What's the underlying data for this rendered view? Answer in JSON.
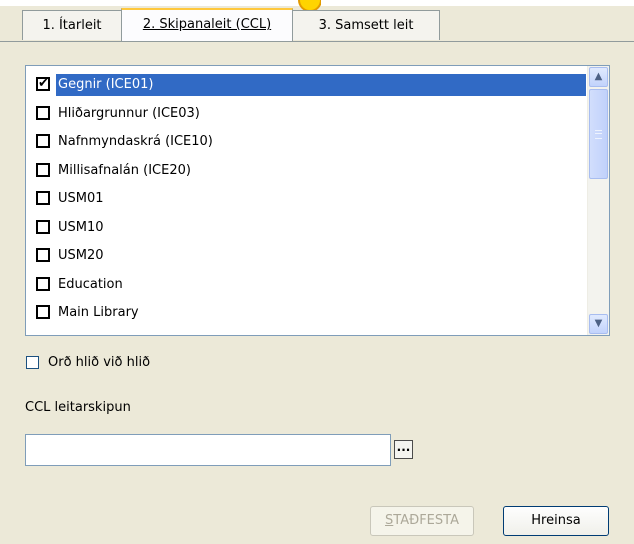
{
  "tabs": [
    {
      "label": "1. Ítarleit",
      "active": false
    },
    {
      "label": "2. Skipanaleit (CCL)",
      "active": true
    },
    {
      "label": "3. Samsett leit",
      "active": false
    }
  ],
  "databases": [
    {
      "label": "Gegnir (ICE01)",
      "checked": true,
      "selected": true
    },
    {
      "label": "Hliðargrunnur (ICE03)",
      "checked": false,
      "selected": false
    },
    {
      "label": "Nafnmyndaskrá (ICE10)",
      "checked": false,
      "selected": false
    },
    {
      "label": "Millisafnalán (ICE20)",
      "checked": false,
      "selected": false
    },
    {
      "label": "USM01",
      "checked": false,
      "selected": false
    },
    {
      "label": "USM10",
      "checked": false,
      "selected": false
    },
    {
      "label": "USM20",
      "checked": false,
      "selected": false
    },
    {
      "label": "Education",
      "checked": false,
      "selected": false
    },
    {
      "label": "Main Library",
      "checked": false,
      "selected": false
    }
  ],
  "side_by_side": {
    "label": "Orð hlið við hlið",
    "checked": false
  },
  "ccl": {
    "label": "CCL leitarskipun",
    "value": "",
    "browse_label": "..."
  },
  "buttons": {
    "confirm_first": "S",
    "confirm_rest": "TAÐFESTA",
    "clear": "Hreinsa"
  },
  "icons": {
    "scroll_up": "chevron-up-icon",
    "scroll_down": "chevron-down-icon",
    "check": "checkmark-icon"
  },
  "colors": {
    "selection": "#316ac5",
    "tab_highlight": "#ffc83c",
    "window_bg": "#ece9d8"
  }
}
